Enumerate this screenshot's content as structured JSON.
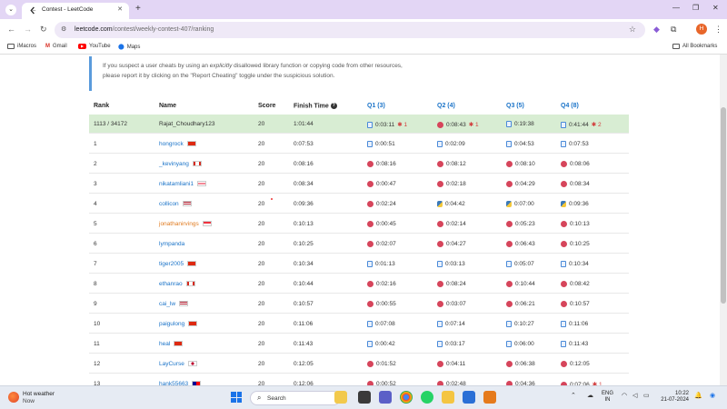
{
  "browser": {
    "tab_title": "Contest - LeetCode",
    "url_host": "leetcode.com",
    "url_path": "/contest/weekly-contest-407/ranking",
    "bookmarks": [
      "iMacros",
      "Gmail",
      "YouTube",
      "Maps"
    ],
    "all_bookmarks": "All Bookmarks",
    "profile_initial": "H"
  },
  "notice": {
    "line1_pre": "If you suspect a user cheats by using an ",
    "line1_em": "explicitly",
    "line1_post": " disallowed library function or copying code from other resources,",
    "line2": "please report it by clicking on the \"Report Cheating\" toggle under the suspicious solution."
  },
  "table": {
    "headers": {
      "rank": "Rank",
      "name": "Name",
      "score": "Score",
      "finish": "Finish Time",
      "q1": "Q1 (3)",
      "q2": "Q2 (4)",
      "q3": "Q3 (5)",
      "q4": "Q4 (8)"
    },
    "rows": [
      {
        "rank": "1113 / 34172",
        "name": "Rajat_Choudhary123",
        "score": "20",
        "finish": "1:01:44",
        "q1": "0:03:11",
        "q1_bug": "1",
        "q2": "0:08:43",
        "q2_bug": "1",
        "q3": "0:19:38",
        "q4": "0:41:44",
        "q4_bug": "2"
      },
      {
        "rank": "1",
        "name": "hongrock",
        "score": "20",
        "finish": "0:07:53",
        "q1": "0:00:51",
        "q2": "0:02:09",
        "q3": "0:04:53",
        "q4": "0:07:53"
      },
      {
        "rank": "2",
        "name": "_kevinyang",
        "score": "20",
        "finish": "0:08:16",
        "q1": "0:08:16",
        "q2": "0:08:12",
        "q3": "0:08:10",
        "q4": "0:08:06"
      },
      {
        "rank": "3",
        "name": "nikatamliani1",
        "score": "20",
        "finish": "0:08:34",
        "q1": "0:00:47",
        "q2": "0:02:18",
        "q3": "0:04:29",
        "q4": "0:08:34"
      },
      {
        "rank": "4",
        "name": "collicon",
        "score": "20",
        "finish": "0:09:36",
        "q1": "0:02:24",
        "q2": "0:04:42",
        "q3": "0:07:00",
        "q4": "0:09:36"
      },
      {
        "rank": "5",
        "name": "jonathanirvings",
        "score": "20",
        "finish": "0:10:13",
        "q1": "0:00:45",
        "q2": "0:02:14",
        "q3": "0:05:23",
        "q4": "0:10:13"
      },
      {
        "rank": "6",
        "name": "lympanda",
        "score": "20",
        "finish": "0:10:25",
        "q1": "0:02:07",
        "q2": "0:04:27",
        "q3": "0:06:43",
        "q4": "0:10:25"
      },
      {
        "rank": "7",
        "name": "tiger2005",
        "score": "20",
        "finish": "0:10:34",
        "q1": "0:01:13",
        "q2": "0:03:13",
        "q3": "0:05:07",
        "q4": "0:10:34"
      },
      {
        "rank": "8",
        "name": "ethanrao",
        "score": "20",
        "finish": "0:10:44",
        "q1": "0:02:16",
        "q2": "0:08:24",
        "q3": "0:10:44",
        "q4": "0:08:42"
      },
      {
        "rank": "9",
        "name": "cai_lw",
        "score": "20",
        "finish": "0:10:57",
        "q1": "0:00:55",
        "q2": "0:03:07",
        "q3": "0:06:21",
        "q4": "0:10:57"
      },
      {
        "rank": "10",
        "name": "paigulong",
        "score": "20",
        "finish": "0:11:06",
        "q1": "0:07:08",
        "q2": "0:07:14",
        "q3": "0:10:27",
        "q4": "0:11:06"
      },
      {
        "rank": "11",
        "name": "heal",
        "score": "20",
        "finish": "0:11:43",
        "q1": "0:00:42",
        "q2": "0:03:17",
        "q3": "0:06:00",
        "q4": "0:11:43"
      },
      {
        "rank": "12",
        "name": "LayCurse",
        "score": "20",
        "finish": "0:12:05",
        "q1": "0:01:52",
        "q2": "0:04:11",
        "q3": "0:06:38",
        "q4": "0:12:05"
      },
      {
        "rank": "13",
        "name": "hank55663",
        "score": "20",
        "finish": "0:12:06",
        "q1": "0:00:52",
        "q2": "0:02:48",
        "q3": "0:04:36",
        "q4": "0:07:06",
        "q4_bug": "1"
      }
    ]
  },
  "taskbar": {
    "weather_line1": "Hot weather",
    "weather_line2": "Now",
    "search_label": "Search",
    "lang_line1": "ENG",
    "lang_line2": "IN",
    "time": "10:22",
    "date": "21-07-2024"
  },
  "colors": {
    "highlight_row": "#d8edd3",
    "link": "#1a73c8",
    "accent_orange": "#e07b20"
  }
}
